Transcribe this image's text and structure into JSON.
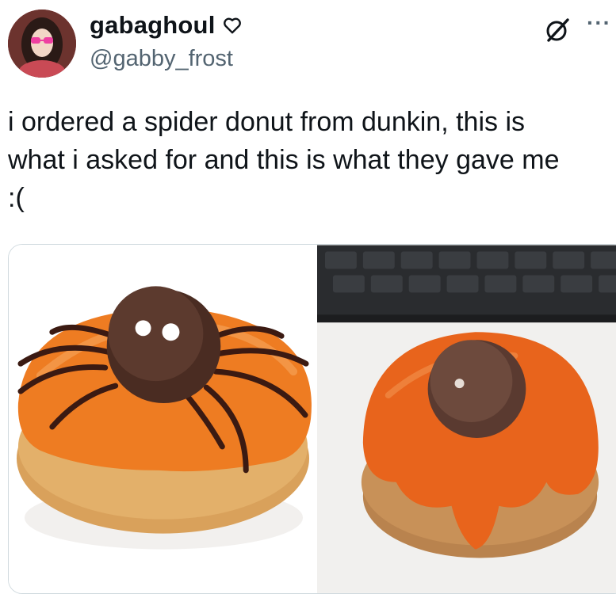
{
  "user": {
    "display_name": "gabaghoul",
    "handle": "@gabby_frost",
    "avatar_icon": "profile-avatar",
    "badge_icon": "heart-outline-icon"
  },
  "toolbar": {
    "grok_icon": "grok-icon",
    "more_label": "···"
  },
  "tweet": {
    "text": "i ordered a spider donut from dunkin, this is\nwhat i asked for and this is what they gave me\n:("
  },
  "media": {
    "images": [
      {
        "name": "spider-donut-expected",
        "description": ""
      },
      {
        "name": "spider-donut-received",
        "description": ""
      }
    ]
  },
  "colors": {
    "text": "#0f1419",
    "secondary": "#536471",
    "border": "#cfd9de",
    "glaze": "#ec7a22"
  }
}
